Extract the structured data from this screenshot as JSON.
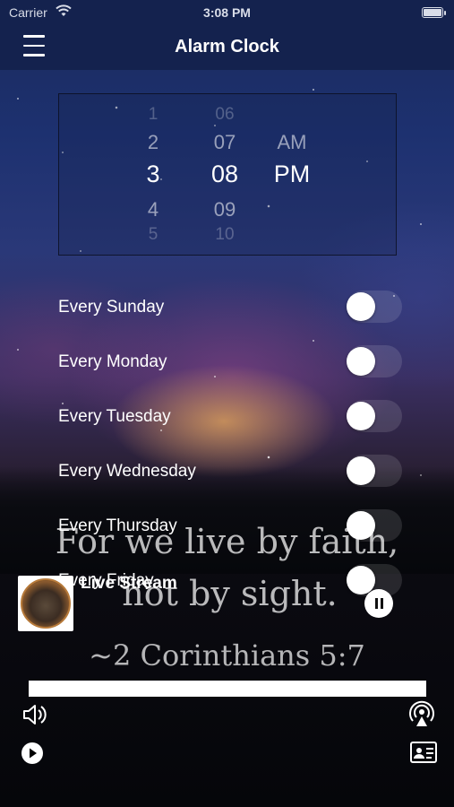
{
  "status_bar": {
    "carrier": "Carrier",
    "time": "3:08 PM"
  },
  "nav": {
    "title": "Alarm Clock",
    "menu_icon": "hamburger-menu-icon"
  },
  "time_picker": {
    "hours": {
      "above2": "1",
      "above1": "2",
      "selected": "3",
      "below1": "4",
      "below2": "5"
    },
    "minutes": {
      "above2": "06",
      "above1": "07",
      "selected": "08",
      "below1": "09",
      "below2": "10"
    },
    "period": {
      "above1": "AM",
      "selected": "PM"
    }
  },
  "repeat_days": [
    {
      "label": "Every Sunday",
      "on": false
    },
    {
      "label": "Every Monday",
      "on": false
    },
    {
      "label": "Every Tuesday",
      "on": false
    },
    {
      "label": "Every Wednesday",
      "on": false
    },
    {
      "label": "Every Thursday",
      "on": false
    },
    {
      "label": "Every Friday",
      "on": false
    }
  ],
  "background_quote": {
    "line1": "For we live by faith,",
    "line2": "not by sight.",
    "reference": "~2 Corinthians 5:7"
  },
  "player": {
    "title": "Live Stream",
    "logo_icon": "station-logo-icon",
    "pause_icon": "pause-icon",
    "volume_icon": "speaker-volume-icon",
    "airplay_icon": "airplay-icon",
    "play_icon": "play-icon",
    "contact_icon": "contact-card-icon"
  }
}
